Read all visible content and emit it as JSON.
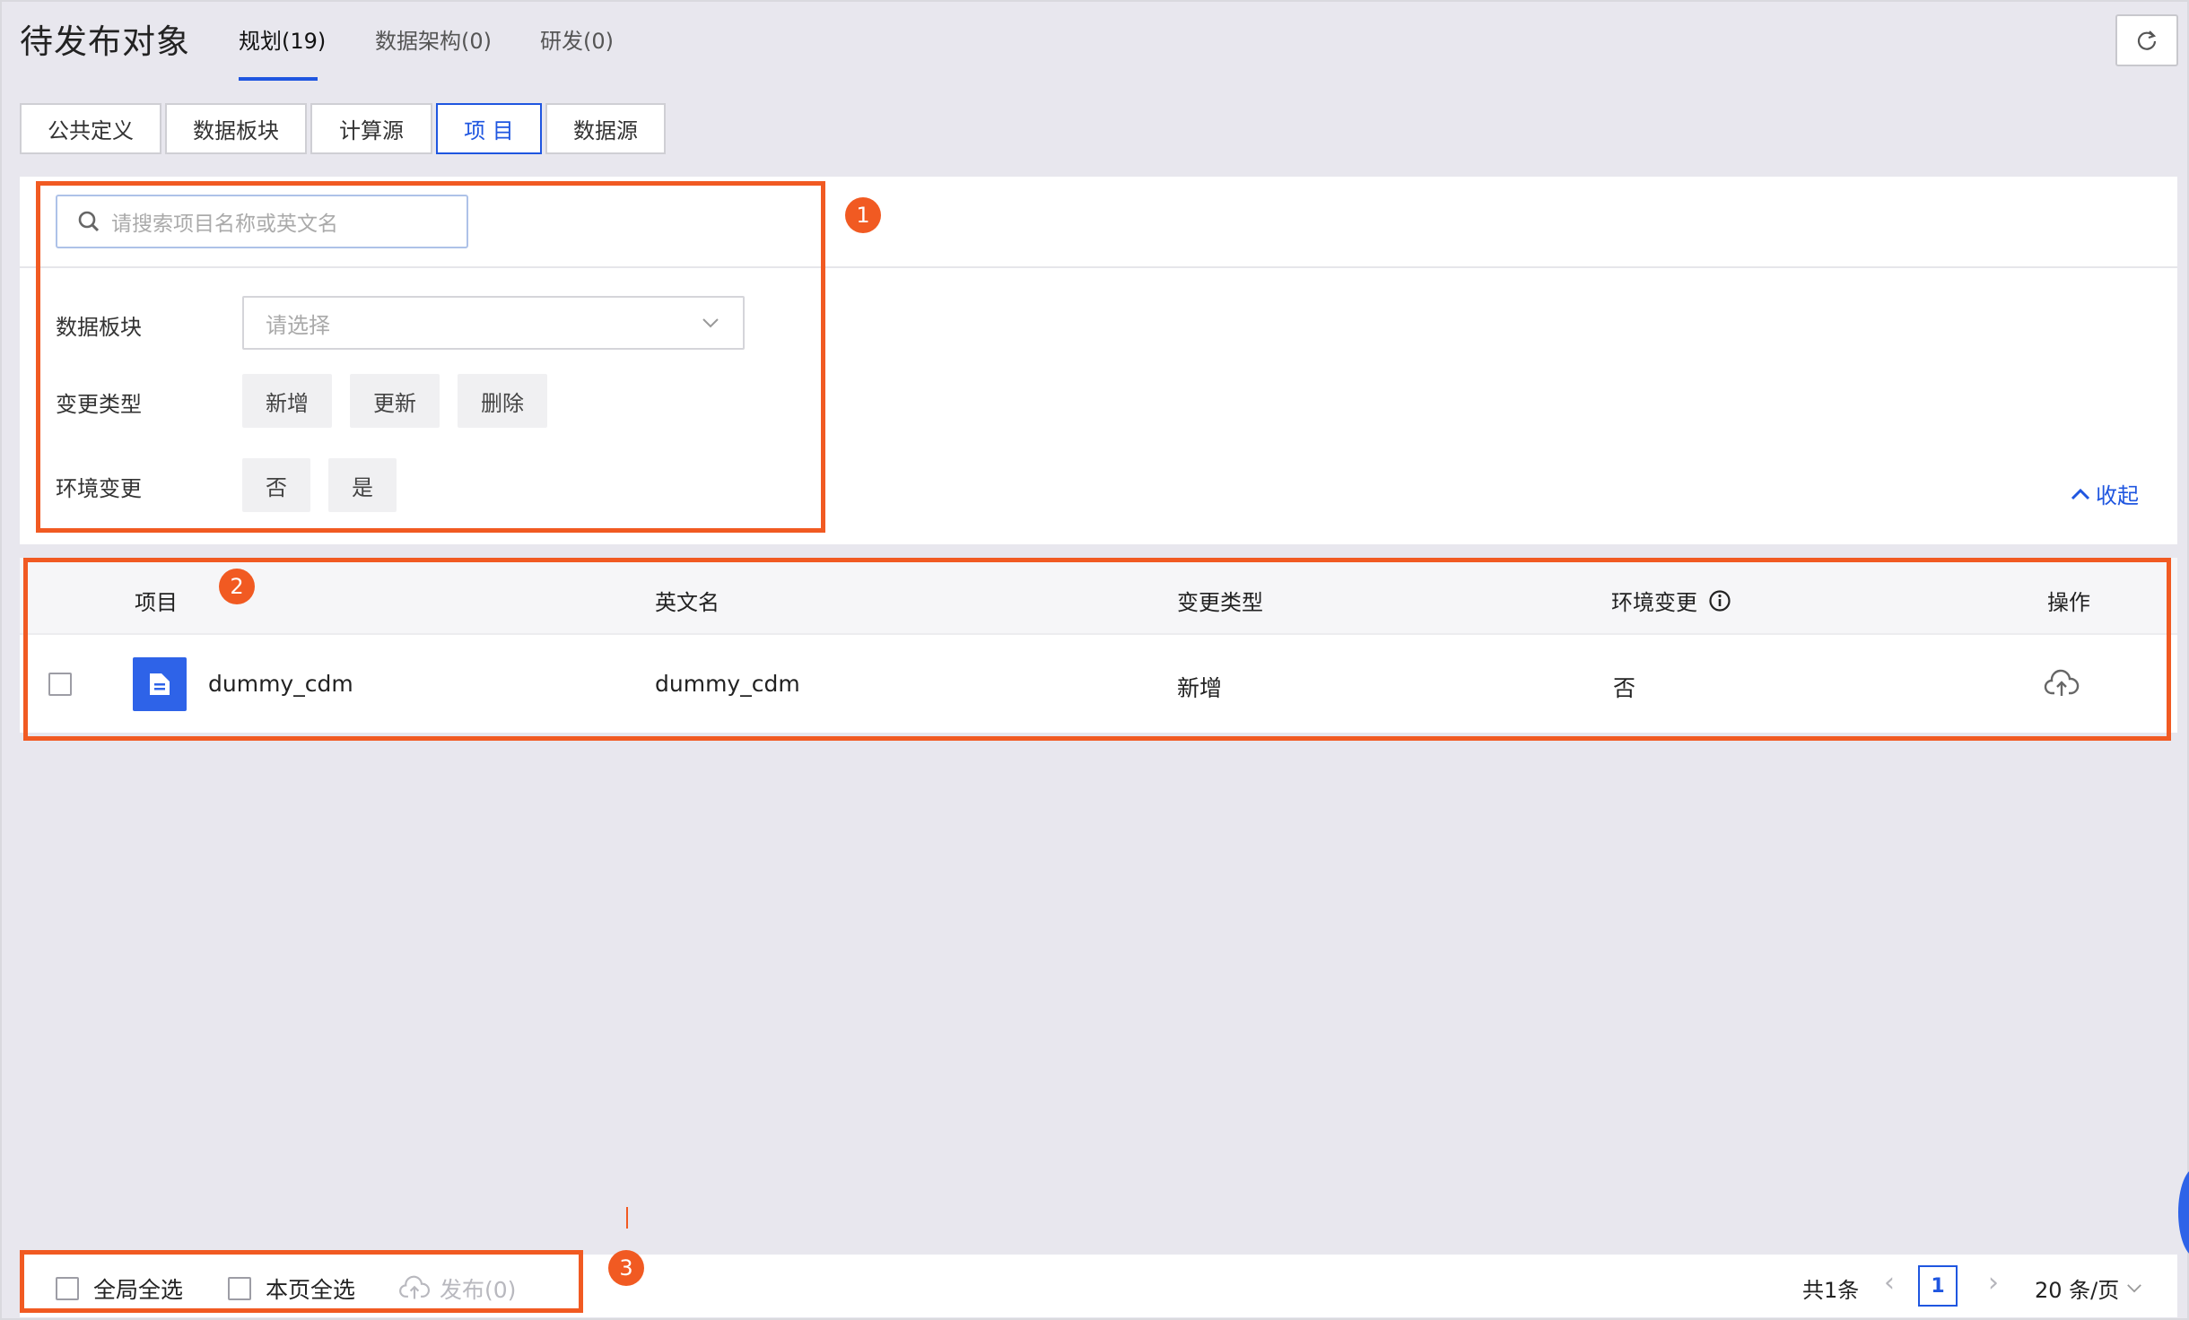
{
  "header": {
    "title": "待发布对象",
    "tabs": [
      {
        "label": "规划(19)"
      },
      {
        "label": "数据架构(0)"
      },
      {
        "label": "研发(0)"
      }
    ]
  },
  "sub_tabs": [
    {
      "label": "公共定义"
    },
    {
      "label": "数据板块"
    },
    {
      "label": "计算源"
    },
    {
      "label": "项 目"
    },
    {
      "label": "数据源"
    }
  ],
  "filter": {
    "search_placeholder": "请搜索项目名称或英文名",
    "block_label": "数据板块",
    "block_placeholder": "请选择",
    "change_type_label": "变更类型",
    "change_types": [
      "新增",
      "更新",
      "删除"
    ],
    "env_change_label": "环境变更",
    "env_options": [
      "否",
      "是"
    ],
    "collapse_label": "收起"
  },
  "table": {
    "headers": {
      "project": "项目",
      "english_name": "英文名",
      "change_type": "变更类型",
      "env_change": "环境变更",
      "action": "操作"
    },
    "rows": [
      {
        "project": "dummy_cdm",
        "english_name": "dummy_cdm",
        "change_type": "新增",
        "env_change": "否"
      }
    ]
  },
  "annotations": [
    "1",
    "2",
    "3"
  ],
  "footer": {
    "select_all_global": "全局全选",
    "select_all_page": "本页全选",
    "publish_label": "发布(0)",
    "total": "共1条",
    "current_page": "1",
    "page_size": "20 条/页"
  },
  "colors": {
    "accent": "#1f56e0",
    "annotation": "#f15a22",
    "icon_blue": "#2e63e8"
  }
}
